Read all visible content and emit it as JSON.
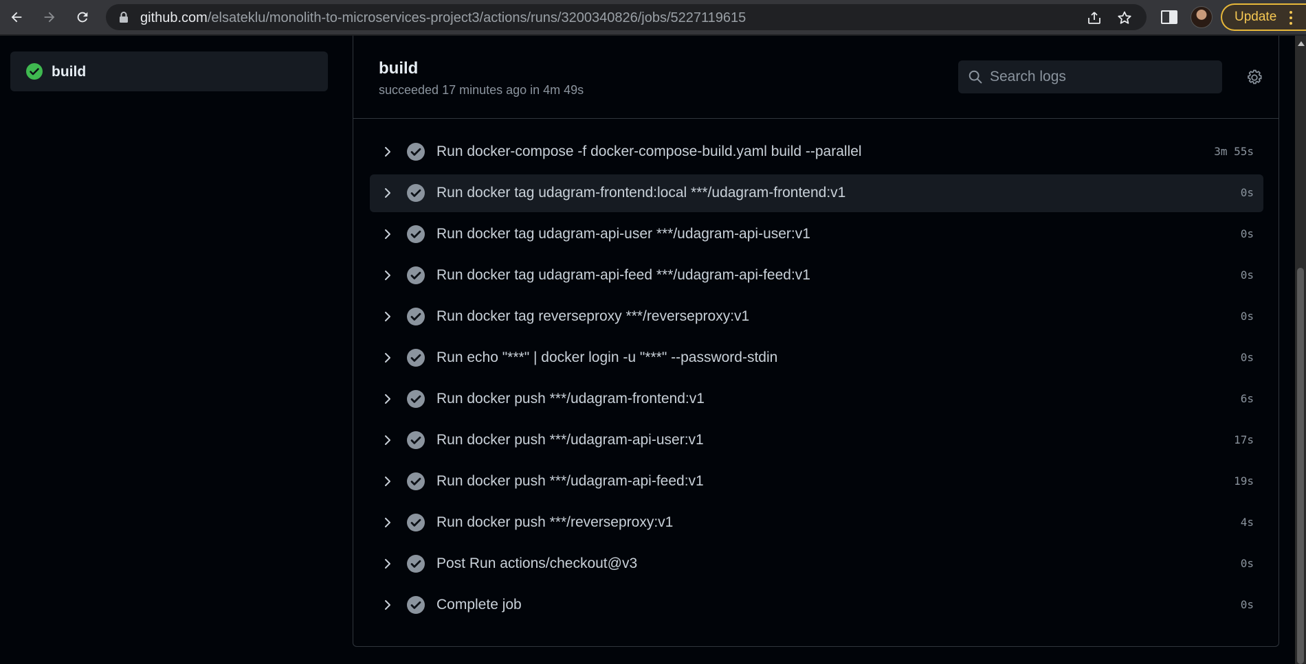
{
  "browser": {
    "url_host": "github.com",
    "url_path": "/elsateklu/monolith-to-microservices-project3/actions/runs/3200340826/jobs/5227119615",
    "update_label": "Update",
    "accent_color": "#f6c853"
  },
  "sidebar": {
    "job_label": "build",
    "status": "success",
    "status_color": "#3fb950"
  },
  "job": {
    "title": "build",
    "meta": "succeeded 17 minutes ago in 4m 49s",
    "search_placeholder": "Search logs"
  },
  "steps": [
    {
      "name": "Run docker-compose -f docker-compose-build.yaml build --parallel",
      "duration": "3m 55s"
    },
    {
      "name": "Run docker tag udagram-frontend:local ***/udagram-frontend:v1",
      "duration": "0s",
      "active": true
    },
    {
      "name": "Run docker tag udagram-api-user ***/udagram-api-user:v1",
      "duration": "0s"
    },
    {
      "name": "Run docker tag udagram-api-feed ***/udagram-api-feed:v1",
      "duration": "0s"
    },
    {
      "name": "Run docker tag reverseproxy ***/reverseproxy:v1",
      "duration": "0s"
    },
    {
      "name": "Run echo \"***\" | docker login -u \"***\" --password-stdin",
      "duration": "0s"
    },
    {
      "name": "Run docker push ***/udagram-frontend:v1",
      "duration": "6s"
    },
    {
      "name": "Run docker push ***/udagram-api-user:v1",
      "duration": "17s"
    },
    {
      "name": "Run docker push ***/udagram-api-feed:v1",
      "duration": "19s"
    },
    {
      "name": "Run docker push ***/reverseproxy:v1",
      "duration": "4s"
    },
    {
      "name": "Post Run actions/checkout@v3",
      "duration": "0s"
    },
    {
      "name": "Complete job",
      "duration": "0s"
    }
  ]
}
